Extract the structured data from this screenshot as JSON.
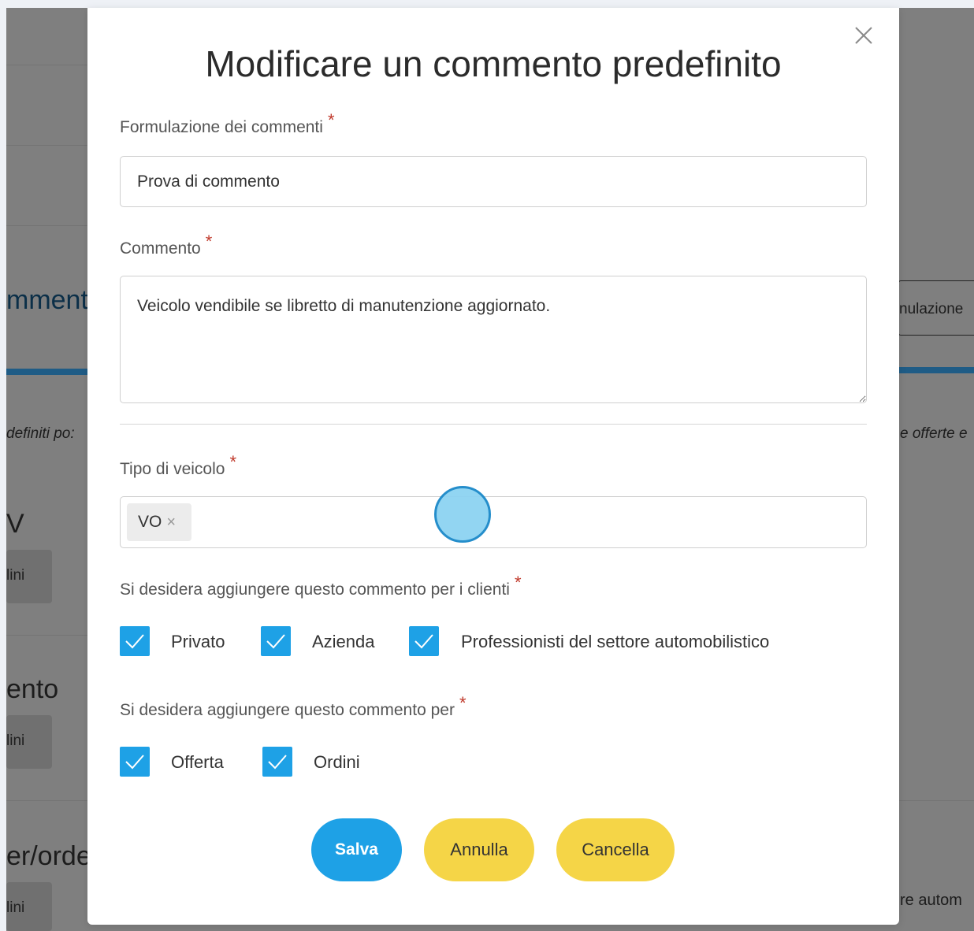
{
  "background": {
    "left_tab_text": "mmenti",
    "right_field_text": "nulazione",
    "left_italic_text": "definiti po:",
    "right_italic_text": "e offerte e",
    "section_v": "V",
    "section_ento": "ento",
    "section_order": "er/orde",
    "pill_label": "lini",
    "right_bottom_text": "re autom"
  },
  "modal": {
    "title": "Modificare un commento predefinito",
    "formulazione_label": "Formulazione dei commenti",
    "formulazione_value": "Prova di commento",
    "commento_label": "Commento",
    "commento_value": "Veicolo vendibile se libretto di manutenzione aggiornato.",
    "tipo_label": "Tipo di veicolo",
    "tipo_chip": "VO",
    "chip_remove": "×",
    "clienti_label": "Si desidera aggiungere questo commento per i clienti",
    "clienti_options": [
      "Privato",
      "Azienda",
      "Professionisti del settore automobilistico"
    ],
    "per_label": "Si desidera aggiungere questo commento per",
    "per_options": [
      "Offerta",
      "Ordini"
    ],
    "required_mark": "*",
    "buttons": {
      "save": "Salva",
      "annulla": "Annulla",
      "cancella": "Cancella"
    }
  },
  "colors": {
    "accent": "#1ea1e6",
    "secondary": "#f5d547",
    "required": "#c0392b"
  }
}
